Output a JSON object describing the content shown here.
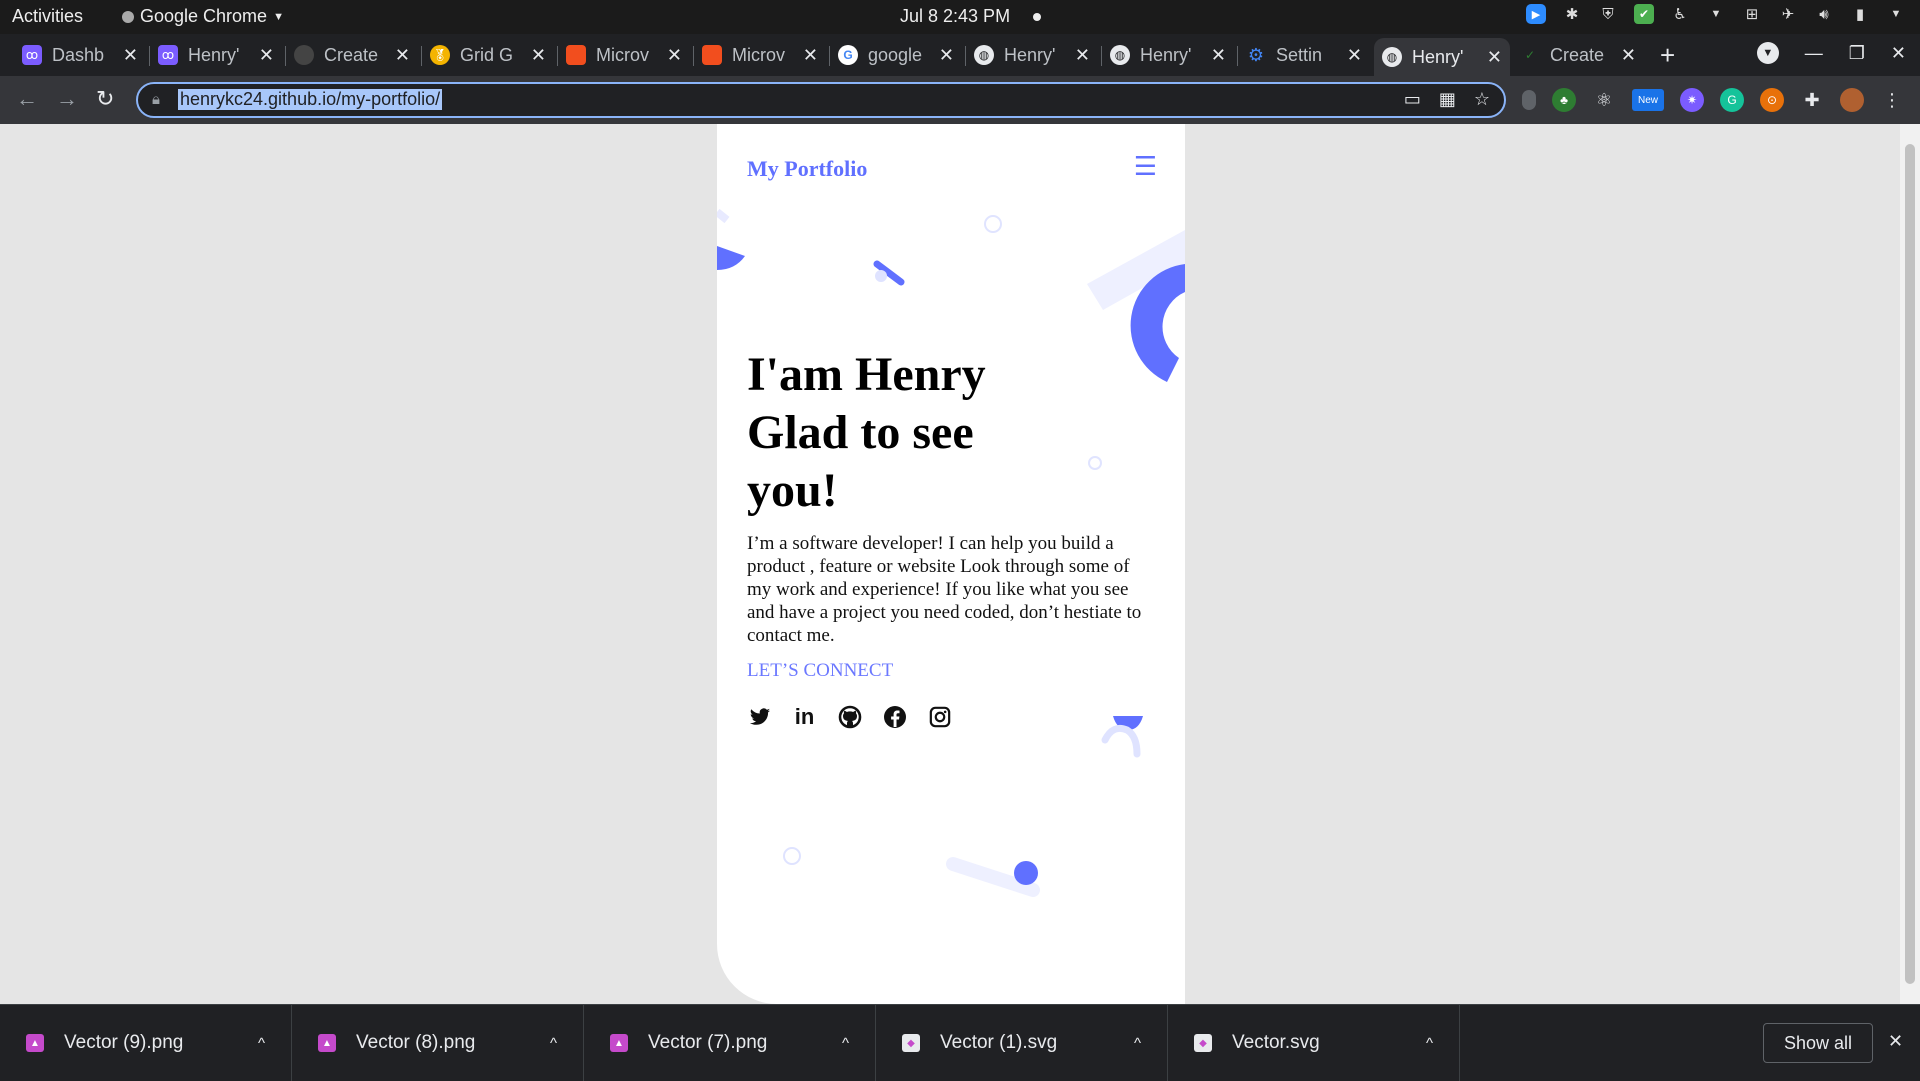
{
  "system": {
    "activities": "Activities",
    "app_name": "Google Chrome",
    "clock": "Jul 8  2:43 PM"
  },
  "tabs": [
    {
      "title": "Dashb",
      "favicon_color": "#7b5cff"
    },
    {
      "title": "Henry'",
      "favicon_color": "#7b5cff"
    },
    {
      "title": "Create",
      "favicon_color": "#444444"
    },
    {
      "title": "Grid G",
      "favicon_color": "#f4b400"
    },
    {
      "title": "Microv",
      "favicon_color": "#f24e1e"
    },
    {
      "title": "Microv",
      "favicon_color": "#f24e1e"
    },
    {
      "title": "google",
      "favicon_color": "#4285f4"
    },
    {
      "title": "Henry'",
      "favicon_color": "#9aa0a6"
    },
    {
      "title": "Henry'",
      "favicon_color": "#9aa0a6"
    },
    {
      "title": "Settin",
      "favicon_color": "#4285f4"
    },
    {
      "title": "Henry'",
      "favicon_color": "#9aa0a6",
      "active": true
    },
    {
      "title": "Create",
      "favicon_color": "#2e7d32"
    }
  ],
  "browser": {
    "url": "henrykc24.github.io/my-portfolio/"
  },
  "portfolio": {
    "brand": "My Portfolio",
    "heading_line1": "I'am Henry",
    "heading_line2": "Glad to see",
    "heading_line3": "you!",
    "intro": "I’m a software developer! I can help you build a product , feature or website Look through some of my work and experience! If you like what you see and have a project you need coded, don’t hestiate to contact me.",
    "cta": "LET’S CONNECT",
    "accent_color": "#6070ff",
    "socials": [
      "twitter-icon",
      "linkedin-icon",
      "github-icon",
      "facebook-icon",
      "instagram-icon"
    ]
  },
  "downloads": {
    "items": [
      {
        "name": "Vector (9).png",
        "type": "png"
      },
      {
        "name": "Vector (8).png",
        "type": "png"
      },
      {
        "name": "Vector (7).png",
        "type": "png"
      },
      {
        "name": "Vector (1).svg",
        "type": "svg"
      },
      {
        "name": "Vector.svg",
        "type": "svg"
      }
    ],
    "show_all": "Show all"
  }
}
